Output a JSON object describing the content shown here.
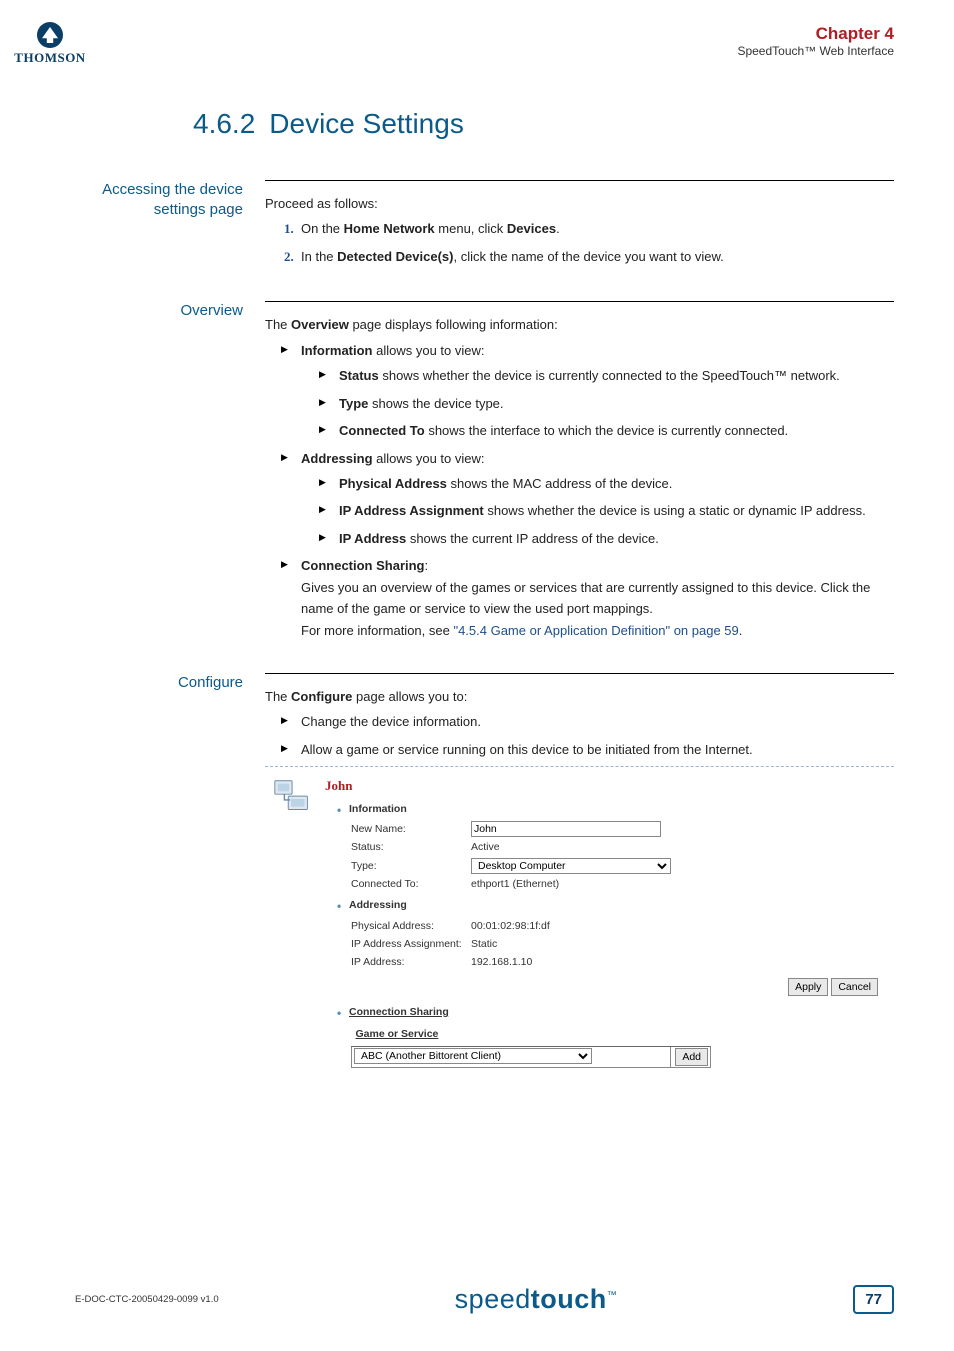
{
  "logo": {
    "brand": "THOMSON"
  },
  "header": {
    "chapter": "Chapter 4",
    "subtitle": "SpeedTouch™ Web Interface"
  },
  "section": {
    "number": "4.6.2",
    "title": "Device Settings"
  },
  "s1": {
    "label": "Accessing the device settings page",
    "intro": "Proceed as follows:",
    "steps": [
      {
        "pre": "On the ",
        "b1": "Home Network",
        "mid": " menu, click ",
        "b2": "Devices",
        "post": "."
      },
      {
        "pre": "In the ",
        "b1": "Detected Device(s)",
        "mid": ", click the name of the device you want to view.",
        "b2": "",
        "post": ""
      }
    ]
  },
  "s2": {
    "label": "Overview",
    "intro_pre": "The ",
    "intro_b": "Overview",
    "intro_post": " page displays following information:",
    "info_h": "Information",
    "info_t": " allows you to view:",
    "info_items": [
      {
        "b": "Status",
        "t": " shows whether the device is currently connected to the SpeedTouch™ network."
      },
      {
        "b": "Type",
        "t": " shows the device type."
      },
      {
        "b": "Connected To",
        "t": " shows the interface to which the device is currently connected."
      }
    ],
    "addr_h": "Addressing",
    "addr_t": " allows you to view:",
    "addr_items": [
      {
        "b": "Physical Address",
        "t": " shows the MAC address of the device."
      },
      {
        "b": "IP Address Assignment",
        "t": " shows whether the device is using a static or dynamic IP address."
      },
      {
        "b": "IP Address",
        "t": " shows the current IP address of the device."
      }
    ],
    "cs_h": "Connection Sharing",
    "cs_t1": "Gives you an overview of the games or services that are currently assigned to this device. Click the name of the game or service to view the used port mappings.",
    "cs_t2_pre": "For more information, see ",
    "cs_link": "\"4.5.4 Game or Application Definition\" on page 59",
    "cs_t2_post": "."
  },
  "s3": {
    "label": "Configure",
    "intro_pre": "The ",
    "intro_b": "Configure",
    "intro_post": " page allows you to:",
    "items": [
      "Change the device information.",
      "Allow a game or service running on this device to be initiated from the Internet."
    ]
  },
  "shot": {
    "title": "John",
    "groups": {
      "info": {
        "heading": "Information",
        "name_k": "New Name:",
        "name_v": "John",
        "status_k": "Status:",
        "status_v": "Active",
        "type_k": "Type:",
        "type_v": "Desktop Computer",
        "conn_k": "Connected To:",
        "conn_v": "ethport1 (Ethernet)"
      },
      "addr": {
        "heading": "Addressing",
        "phys_k": "Physical Address:",
        "phys_v": "00:01:02:98:1f:df",
        "asgn_k": "IP Address Assignment:",
        "asgn_v": "Static",
        "ip_k": "IP Address:",
        "ip_v": "192.168.1.10"
      },
      "cs": {
        "heading": "Connection Sharing",
        "col": "Game or Service",
        "sel": "ABC (Another Bittorent Client)",
        "add": "Add"
      }
    },
    "buttons": {
      "apply": "Apply",
      "cancel": "Cancel"
    }
  },
  "footer": {
    "docid": "E-DOC-CTC-20050429-0099 v1.0",
    "logo_light": "speed",
    "logo_heavy": "touch",
    "tm": "™",
    "page": "77"
  }
}
